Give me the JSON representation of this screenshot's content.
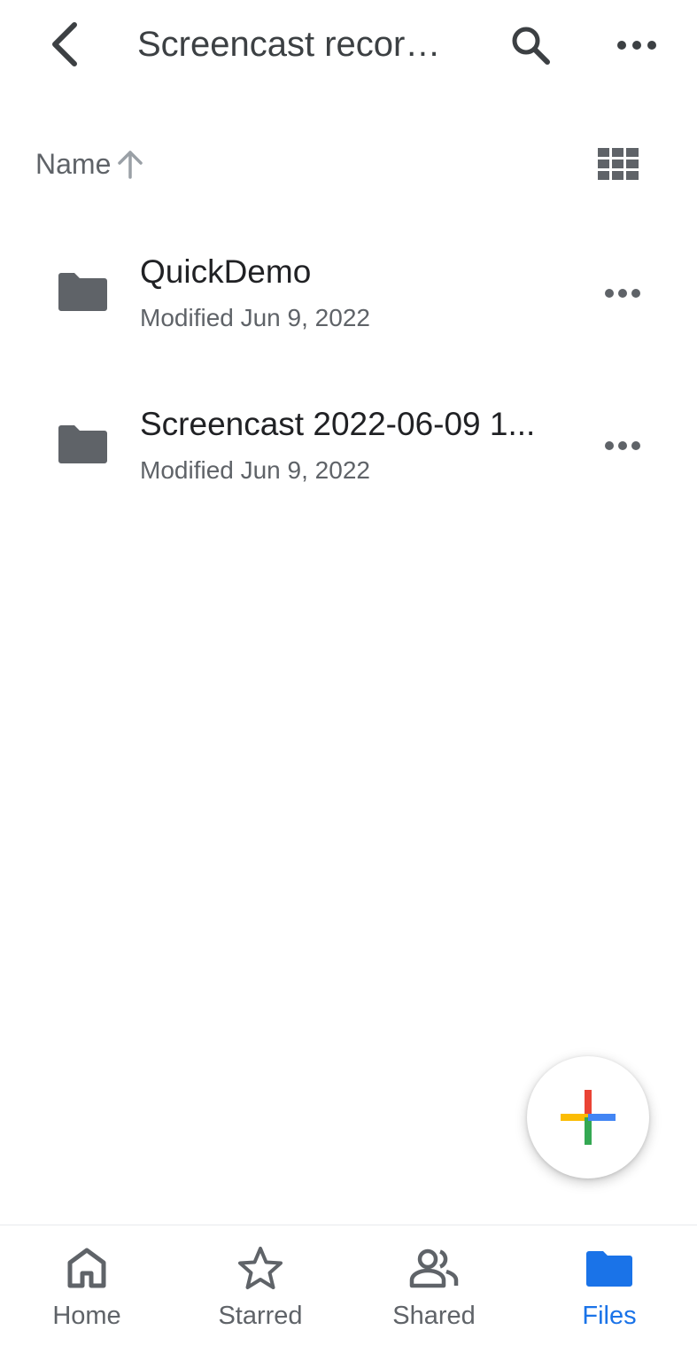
{
  "header": {
    "title": "Screencast recor…",
    "back_icon": "chevron-left-icon",
    "search_icon": "search-icon",
    "more_icon": "more-horizontal-icon"
  },
  "sort": {
    "label": "Name",
    "direction_icon": "arrow-up-icon",
    "view_toggle_icon": "grid-view-icon"
  },
  "files": [
    {
      "name": "QuickDemo",
      "meta": "Modified Jun 9, 2022",
      "icon": "folder-icon"
    },
    {
      "name": "Screencast 2022-06-09 1...",
      "meta": "Modified Jun 9, 2022",
      "icon": "folder-icon"
    }
  ],
  "fab": {
    "icon": "plus-icon",
    "colors": {
      "red": "#ea4335",
      "yellow": "#fbbc04",
      "green": "#34a853",
      "blue": "#4285f4"
    }
  },
  "bottom_nav": {
    "items": [
      {
        "label": "Home",
        "icon": "home-icon",
        "active": false
      },
      {
        "label": "Starred",
        "icon": "star-icon",
        "active": false
      },
      {
        "label": "Shared",
        "icon": "people-icon",
        "active": false
      },
      {
        "label": "Files",
        "icon": "folder-icon",
        "active": true
      }
    ]
  },
  "colors": {
    "text_primary": "#202124",
    "text_secondary": "#5f6368",
    "icon": "#5f6368",
    "accent": "#1a73e8"
  }
}
